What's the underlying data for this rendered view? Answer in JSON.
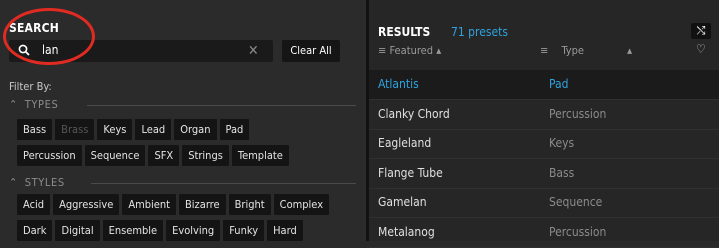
{
  "search": {
    "title": "SEARCH",
    "query": "lan",
    "clear_label": "Clear All",
    "filter_by": "Filter By:"
  },
  "types": {
    "header": "TYPES",
    "rows": [
      [
        {
          "label": "Bass",
          "dim": false
        },
        {
          "label": "Brass",
          "dim": true
        },
        {
          "label": "Keys",
          "dim": false
        },
        {
          "label": "Lead",
          "dim": false
        },
        {
          "label": "Organ",
          "dim": false
        },
        {
          "label": "Pad",
          "dim": false
        }
      ],
      [
        {
          "label": "Percussion",
          "dim": false
        },
        {
          "label": "Sequence",
          "dim": false
        },
        {
          "label": "SFX",
          "dim": false
        },
        {
          "label": "Strings",
          "dim": false
        },
        {
          "label": "Template",
          "dim": false
        }
      ]
    ]
  },
  "styles": {
    "header": "STYLES",
    "rows": [
      [
        {
          "label": "Acid",
          "dim": false
        },
        {
          "label": "Aggressive",
          "dim": false
        },
        {
          "label": "Ambient",
          "dim": false
        },
        {
          "label": "Bizarre",
          "dim": false
        },
        {
          "label": "Bright",
          "dim": false
        },
        {
          "label": "Complex",
          "dim": false
        }
      ],
      [
        {
          "label": "Dark",
          "dim": false
        },
        {
          "label": "Digital",
          "dim": false
        },
        {
          "label": "Ensemble",
          "dim": false
        },
        {
          "label": "Evolving",
          "dim": false
        },
        {
          "label": "Funky",
          "dim": false
        },
        {
          "label": "Hard",
          "dim": false
        }
      ]
    ]
  },
  "results": {
    "title": "RESULTS",
    "count": "71 presets",
    "col_featured": "Featured",
    "col_type": "Type",
    "items": [
      {
        "name": "Atlantis",
        "type": "Pad",
        "selected": true
      },
      {
        "name": "Clanky Chord",
        "type": "Percussion",
        "selected": false
      },
      {
        "name": "Eagleland",
        "type": "Keys",
        "selected": false
      },
      {
        "name": "Flange Tube",
        "type": "Bass",
        "selected": false
      },
      {
        "name": "Gamelan",
        "type": "Sequence",
        "selected": false
      },
      {
        "name": "Metalanog",
        "type": "Percussion",
        "selected": false
      }
    ]
  },
  "colors": {
    "accent": "#2fa3de",
    "callout": "#e12b22",
    "chip_bg": "#141414"
  },
  "icons": {
    "search": "magnifier-icon",
    "clear": "close-icon",
    "shuffle": "shuffle-icon",
    "favorite": "heart-icon"
  }
}
